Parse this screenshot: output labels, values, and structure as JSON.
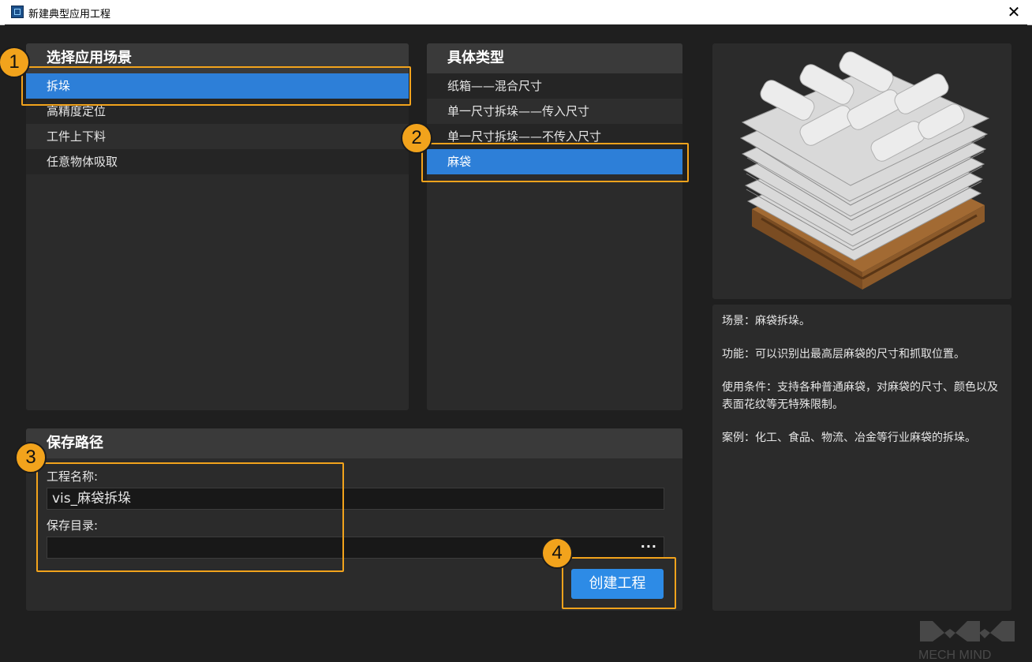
{
  "window": {
    "title": "新建典型应用工程",
    "close_glyph": "✕"
  },
  "scenario": {
    "header": "选择应用场景",
    "items": [
      "拆垛",
      "高精度定位",
      "工件上下料",
      "任意物体吸取"
    ],
    "selected_index": 0
  },
  "type": {
    "header": "具体类型",
    "items": [
      "纸箱——混合尺寸",
      "单一尺寸拆垛——传入尺寸",
      "单一尺寸拆垛——不传入尺寸",
      "麻袋"
    ],
    "selected_index": 3
  },
  "save": {
    "header": "保存路径",
    "name_label": "工程名称:",
    "name_value": "vis_麻袋拆垛",
    "dir_label": "保存目录:",
    "dir_value": "",
    "browse_label": "···",
    "create_label": "创建工程"
  },
  "description": {
    "lines": [
      "场景：麻袋拆垛。",
      "功能：可以识别出最高层麻袋的尺寸和抓取位置。",
      "使用条件：支持各种普通麻袋，对麻袋的尺寸、颜色以及表面花纹等无特殊限制。",
      "案例：化工、食品、物流、冶金等行业麻袋的拆垛。"
    ]
  },
  "preview": {
    "image_icon": "sack-pallet-image"
  },
  "callouts": {
    "step1": "1",
    "step2": "2",
    "step3": "3",
    "step4": "4"
  },
  "watermark": {
    "text": "MECH MIND"
  },
  "colors": {
    "accent": "#2d7fd8",
    "callout": "#f2a31c",
    "background": "#1f1f1f",
    "panel": "#2b2b2b"
  }
}
